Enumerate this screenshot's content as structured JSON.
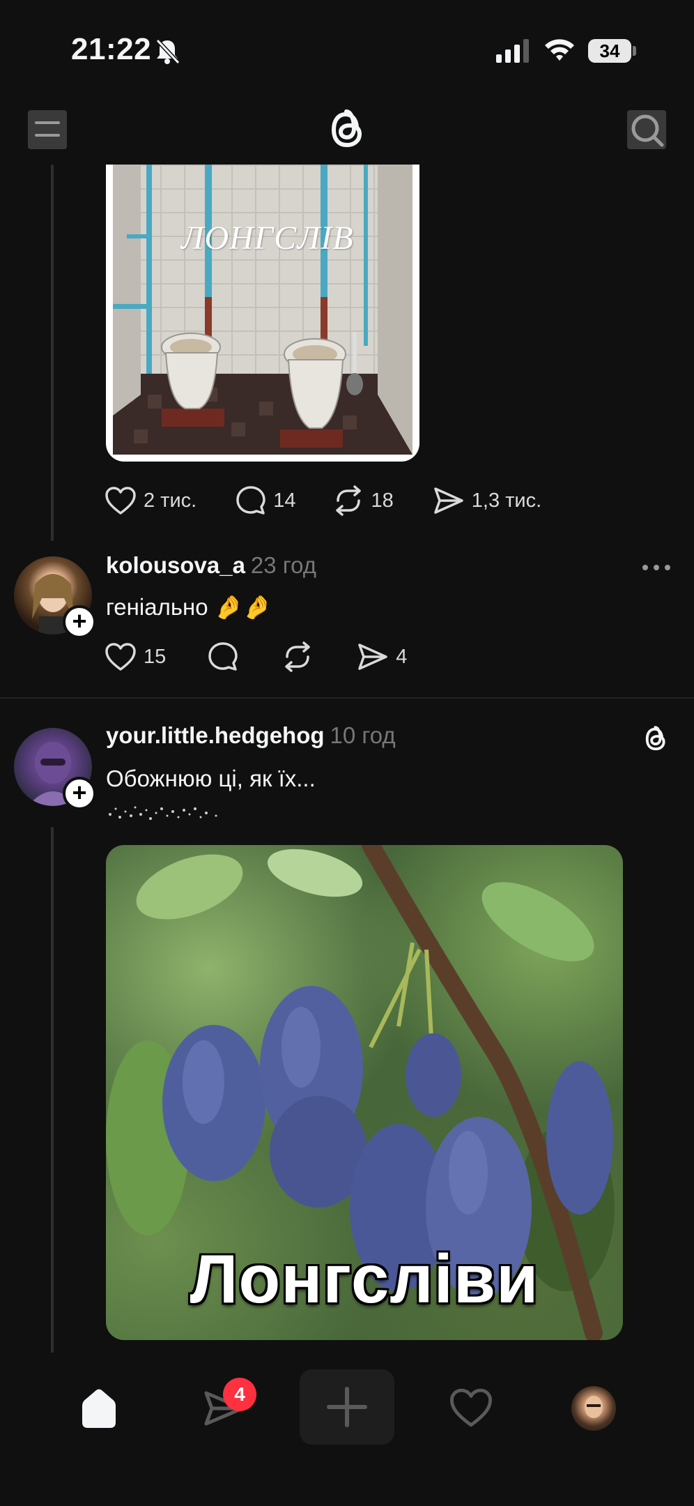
{
  "status_bar": {
    "time": "21:22",
    "battery": "34"
  },
  "colors": {
    "background": "#101010",
    "text_primary": "#f3f5f7",
    "text_secondary": "#777777",
    "badge_red": "#ff3040"
  },
  "top_nav": {
    "menu_icon": "menu-icon",
    "logo_icon": "threads-logo-icon",
    "search_icon": "search-icon"
  },
  "post1": {
    "image_caption": "ЛОНГСЛІВ",
    "likes": "2 тис.",
    "comments": "14",
    "reposts": "18",
    "shares": "1,3 тис."
  },
  "comment": {
    "username": "kolousova_a",
    "time_ago": "23 год",
    "text": "геніально 🤌🤌",
    "likes": "15",
    "shares": "4"
  },
  "post2": {
    "username": "your.little.hedgehog",
    "time_ago": "10 год",
    "text": "Обожнюю ці, як їх...",
    "image_caption": "Лонгсліви"
  },
  "bottom_nav": {
    "messages_badge": "4",
    "items": [
      "home-icon",
      "messages-icon",
      "create-icon",
      "activity-icon",
      "profile-avatar"
    ]
  }
}
